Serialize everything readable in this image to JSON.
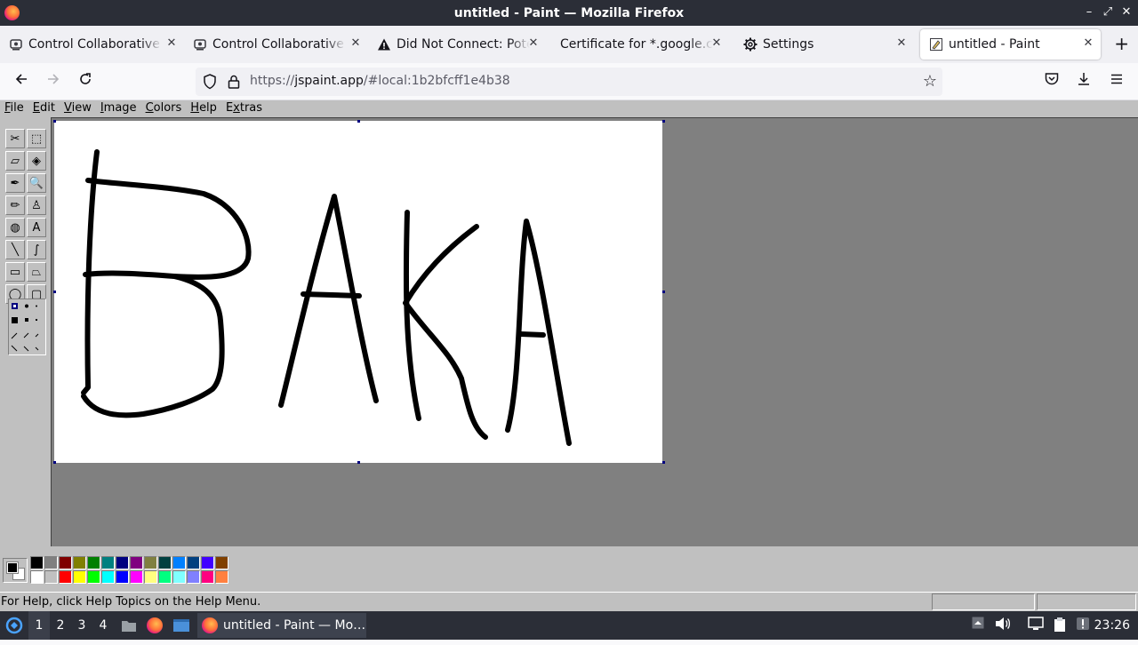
{
  "window": {
    "title": "untitled - Paint — Mozilla Firefox",
    "controls": [
      "–",
      "⤢",
      "✕"
    ]
  },
  "tabs": [
    {
      "label": "Control Collaborative V",
      "icon": "extension-icon",
      "active": false
    },
    {
      "label": "Control Collaborative V",
      "icon": "extension-icon",
      "active": false
    },
    {
      "label": "Did Not Connect: Poten",
      "icon": "warning-icon",
      "active": false
    },
    {
      "label": "Certificate for *.google.co",
      "icon": "",
      "active": false
    },
    {
      "label": "Settings",
      "icon": "gear-icon",
      "active": false
    },
    {
      "label": "untitled - Paint",
      "icon": "paint-icon",
      "active": true
    }
  ],
  "new_tab": "+",
  "nav": {
    "url_prefix": "https://",
    "url_host": "jspaint.app",
    "url_rest": "/#local:1b2bfcff1e4b38"
  },
  "paint": {
    "menus": [
      {
        "label": "File",
        "accel": "F",
        "rest": "ile"
      },
      {
        "label": "Edit",
        "accel": "E",
        "rest": "dit"
      },
      {
        "label": "View",
        "accel": "V",
        "rest": "iew"
      },
      {
        "label": "Image",
        "accel": "I",
        "rest": "mage"
      },
      {
        "label": "Colors",
        "accel": "C",
        "rest": "olors"
      },
      {
        "label": "Help",
        "accel": "H",
        "rest": "elp"
      },
      {
        "label": "Extras",
        "accel": "x",
        "pre": "E",
        "rest": "tras"
      }
    ],
    "tools": [
      {
        "name": "free-form-select-tool",
        "glyph": "✂"
      },
      {
        "name": "select-tool",
        "glyph": "⬚"
      },
      {
        "name": "eraser-tool",
        "glyph": "▱"
      },
      {
        "name": "fill-tool",
        "glyph": "◈"
      },
      {
        "name": "pick-color-tool",
        "glyph": "✒"
      },
      {
        "name": "magnifier-tool",
        "glyph": "🔍"
      },
      {
        "name": "pencil-tool",
        "glyph": "✏"
      },
      {
        "name": "brush-tool",
        "glyph": "♙"
      },
      {
        "name": "airbrush-tool",
        "glyph": "◍"
      },
      {
        "name": "text-tool",
        "glyph": "A"
      },
      {
        "name": "line-tool",
        "glyph": "╲"
      },
      {
        "name": "curve-tool",
        "glyph": "∫"
      },
      {
        "name": "rectangle-tool",
        "glyph": "▭"
      },
      {
        "name": "polygon-tool",
        "glyph": "⏢"
      },
      {
        "name": "ellipse-tool",
        "glyph": "◯"
      },
      {
        "name": "rounded-rectangle-tool",
        "glyph": "▢"
      }
    ],
    "foreground_color": "#000000",
    "background_color": "#ffffff",
    "palette_top": [
      "#000000",
      "#808080",
      "#800000",
      "#808000",
      "#008000",
      "#008080",
      "#000080",
      "#800080",
      "#808040",
      "#004040",
      "#0080ff",
      "#004080",
      "#4000ff",
      "#804000"
    ],
    "palette_bottom": [
      "#ffffff",
      "#c0c0c0",
      "#ff0000",
      "#ffff00",
      "#00ff00",
      "#00ffff",
      "#0000ff",
      "#ff00ff",
      "#ffff80",
      "#00ff80",
      "#80ffff",
      "#8080ff",
      "#ff0080",
      "#ff8040"
    ],
    "status_text": "For Help, click Help Topics on the Help Menu.",
    "drawing_text": "BAKA"
  },
  "taskbar": {
    "workspaces": [
      "1",
      "2",
      "3",
      "4"
    ],
    "app_label": "untitled - Paint — Mo…",
    "clock": "23:26"
  }
}
